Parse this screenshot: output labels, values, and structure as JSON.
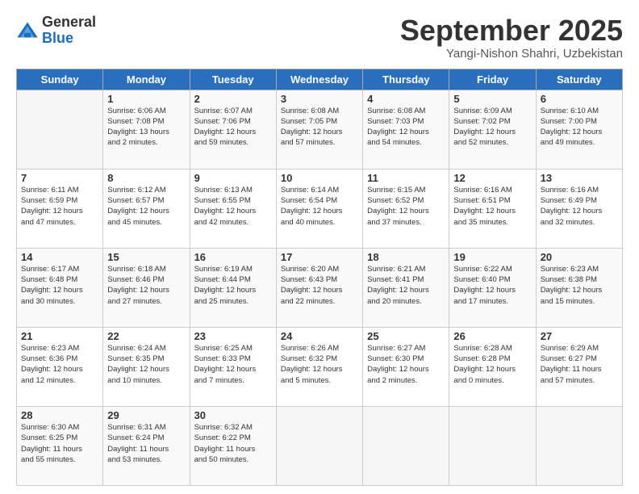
{
  "logo": {
    "general": "General",
    "blue": "Blue"
  },
  "title": "September 2025",
  "location": "Yangi-Nishon Shahri, Uzbekistan",
  "days_header": [
    "Sunday",
    "Monday",
    "Tuesday",
    "Wednesday",
    "Thursday",
    "Friday",
    "Saturday"
  ],
  "weeks": [
    [
      {
        "day": "",
        "info": ""
      },
      {
        "day": "1",
        "info": "Sunrise: 6:06 AM\nSunset: 7:08 PM\nDaylight: 13 hours\nand 2 minutes."
      },
      {
        "day": "2",
        "info": "Sunrise: 6:07 AM\nSunset: 7:06 PM\nDaylight: 12 hours\nand 59 minutes."
      },
      {
        "day": "3",
        "info": "Sunrise: 6:08 AM\nSunset: 7:05 PM\nDaylight: 12 hours\nand 57 minutes."
      },
      {
        "day": "4",
        "info": "Sunrise: 6:08 AM\nSunset: 7:03 PM\nDaylight: 12 hours\nand 54 minutes."
      },
      {
        "day": "5",
        "info": "Sunrise: 6:09 AM\nSunset: 7:02 PM\nDaylight: 12 hours\nand 52 minutes."
      },
      {
        "day": "6",
        "info": "Sunrise: 6:10 AM\nSunset: 7:00 PM\nDaylight: 12 hours\nand 49 minutes."
      }
    ],
    [
      {
        "day": "7",
        "info": "Sunrise: 6:11 AM\nSunset: 6:59 PM\nDaylight: 12 hours\nand 47 minutes."
      },
      {
        "day": "8",
        "info": "Sunrise: 6:12 AM\nSunset: 6:57 PM\nDaylight: 12 hours\nand 45 minutes."
      },
      {
        "day": "9",
        "info": "Sunrise: 6:13 AM\nSunset: 6:55 PM\nDaylight: 12 hours\nand 42 minutes."
      },
      {
        "day": "10",
        "info": "Sunrise: 6:14 AM\nSunset: 6:54 PM\nDaylight: 12 hours\nand 40 minutes."
      },
      {
        "day": "11",
        "info": "Sunrise: 6:15 AM\nSunset: 6:52 PM\nDaylight: 12 hours\nand 37 minutes."
      },
      {
        "day": "12",
        "info": "Sunrise: 6:16 AM\nSunset: 6:51 PM\nDaylight: 12 hours\nand 35 minutes."
      },
      {
        "day": "13",
        "info": "Sunrise: 6:16 AM\nSunset: 6:49 PM\nDaylight: 12 hours\nand 32 minutes."
      }
    ],
    [
      {
        "day": "14",
        "info": "Sunrise: 6:17 AM\nSunset: 6:48 PM\nDaylight: 12 hours\nand 30 minutes."
      },
      {
        "day": "15",
        "info": "Sunrise: 6:18 AM\nSunset: 6:46 PM\nDaylight: 12 hours\nand 27 minutes."
      },
      {
        "day": "16",
        "info": "Sunrise: 6:19 AM\nSunset: 6:44 PM\nDaylight: 12 hours\nand 25 minutes."
      },
      {
        "day": "17",
        "info": "Sunrise: 6:20 AM\nSunset: 6:43 PM\nDaylight: 12 hours\nand 22 minutes."
      },
      {
        "day": "18",
        "info": "Sunrise: 6:21 AM\nSunset: 6:41 PM\nDaylight: 12 hours\nand 20 minutes."
      },
      {
        "day": "19",
        "info": "Sunrise: 6:22 AM\nSunset: 6:40 PM\nDaylight: 12 hours\nand 17 minutes."
      },
      {
        "day": "20",
        "info": "Sunrise: 6:23 AM\nSunset: 6:38 PM\nDaylight: 12 hours\nand 15 minutes."
      }
    ],
    [
      {
        "day": "21",
        "info": "Sunrise: 6:23 AM\nSunset: 6:36 PM\nDaylight: 12 hours\nand 12 minutes."
      },
      {
        "day": "22",
        "info": "Sunrise: 6:24 AM\nSunset: 6:35 PM\nDaylight: 12 hours\nand 10 minutes."
      },
      {
        "day": "23",
        "info": "Sunrise: 6:25 AM\nSunset: 6:33 PM\nDaylight: 12 hours\nand 7 minutes."
      },
      {
        "day": "24",
        "info": "Sunrise: 6:26 AM\nSunset: 6:32 PM\nDaylight: 12 hours\nand 5 minutes."
      },
      {
        "day": "25",
        "info": "Sunrise: 6:27 AM\nSunset: 6:30 PM\nDaylight: 12 hours\nand 2 minutes."
      },
      {
        "day": "26",
        "info": "Sunrise: 6:28 AM\nSunset: 6:28 PM\nDaylight: 12 hours\nand 0 minutes."
      },
      {
        "day": "27",
        "info": "Sunrise: 6:29 AM\nSunset: 6:27 PM\nDaylight: 11 hours\nand 57 minutes."
      }
    ],
    [
      {
        "day": "28",
        "info": "Sunrise: 6:30 AM\nSunset: 6:25 PM\nDaylight: 11 hours\nand 55 minutes."
      },
      {
        "day": "29",
        "info": "Sunrise: 6:31 AM\nSunset: 6:24 PM\nDaylight: 11 hours\nand 53 minutes."
      },
      {
        "day": "30",
        "info": "Sunrise: 6:32 AM\nSunset: 6:22 PM\nDaylight: 11 hours\nand 50 minutes."
      },
      {
        "day": "",
        "info": ""
      },
      {
        "day": "",
        "info": ""
      },
      {
        "day": "",
        "info": ""
      },
      {
        "day": "",
        "info": ""
      }
    ]
  ]
}
